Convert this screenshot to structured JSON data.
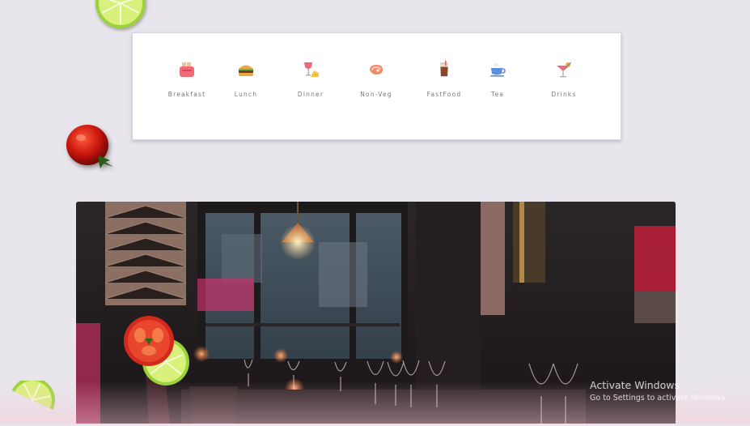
{
  "categories": [
    {
      "label": "Breakfast",
      "icon": "toaster-icon"
    },
    {
      "label": "Lunch",
      "icon": "burger-icon"
    },
    {
      "label": "Dinner",
      "icon": "wine-cheese-icon"
    },
    {
      "label": "Non-Veg",
      "icon": "steak-icon"
    },
    {
      "label": "FastFood",
      "icon": "latte-glass-icon"
    },
    {
      "label": "Tea",
      "icon": "tea-cup-icon"
    },
    {
      "label": "Drinks",
      "icon": "cocktail-icon"
    }
  ],
  "hero": {
    "image": "restaurant-interior-photo"
  },
  "watermark": {
    "title": "Activate Windows",
    "subtitle": "Go to Settings to activate Windows."
  }
}
